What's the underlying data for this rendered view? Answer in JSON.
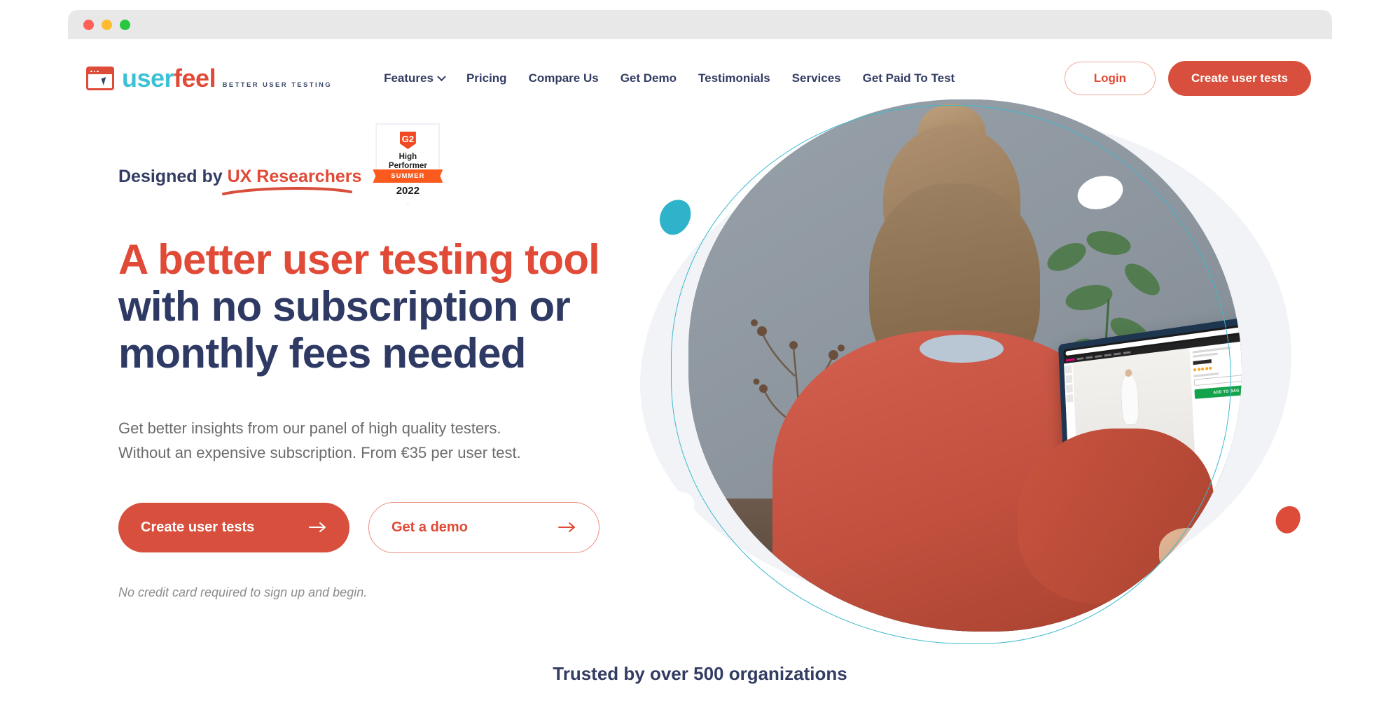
{
  "window": {
    "traffic_lights": [
      "close",
      "minimize",
      "maximize"
    ]
  },
  "brand": {
    "name_part1": "user",
    "name_part2": "feel",
    "tagline": "BETTER USER TESTING",
    "mark_icon": "browser-window-cursor-icon"
  },
  "nav": {
    "items": [
      {
        "label": "Features",
        "has_dropdown": true
      },
      {
        "label": "Pricing",
        "has_dropdown": false
      },
      {
        "label": "Compare Us",
        "has_dropdown": false
      },
      {
        "label": "Get Demo",
        "has_dropdown": false
      },
      {
        "label": "Testimonials",
        "has_dropdown": false
      },
      {
        "label": "Services",
        "has_dropdown": false
      },
      {
        "label": "Get Paid To Test",
        "has_dropdown": false
      }
    ],
    "login_label": "Login",
    "cta_label": "Create user tests"
  },
  "hero": {
    "eyebrow_prefix": "Designed by ",
    "eyebrow_highlight": "UX Researchers",
    "headline_line1": "A better user testing tool",
    "headline_line2": "with no subscription or",
    "headline_line3": "monthly fees needed",
    "subhead_line1": "Get better insights from our panel of high quality testers.",
    "subhead_line2": "Without an expensive subscription. From €35 per user test.",
    "price": "€35",
    "primary_cta": "Create user tests",
    "secondary_cta": "Get a demo",
    "fineprint": "No credit card required to sign up and begin.",
    "arrow_icon": "arrow-right-icon"
  },
  "badge": {
    "logo": "G2",
    "title_line1": "High",
    "title_line2": "Performer",
    "season": "SUMMER",
    "year": "2022"
  },
  "photo": {
    "alt": "woman-at-desk-using-laptop",
    "laptop_screen": {
      "add_to_bag_label": "ADD TO BAG"
    }
  },
  "trusted": {
    "text": "Trusted by over 500 organizations"
  },
  "colors": {
    "coral": "#d8503d",
    "coral_text": "#e04a36",
    "navy": "#333d63",
    "teal": "#3cc1d4",
    "gray_text": "#6c6c6c",
    "badge_orange": "#fa5a1e"
  }
}
